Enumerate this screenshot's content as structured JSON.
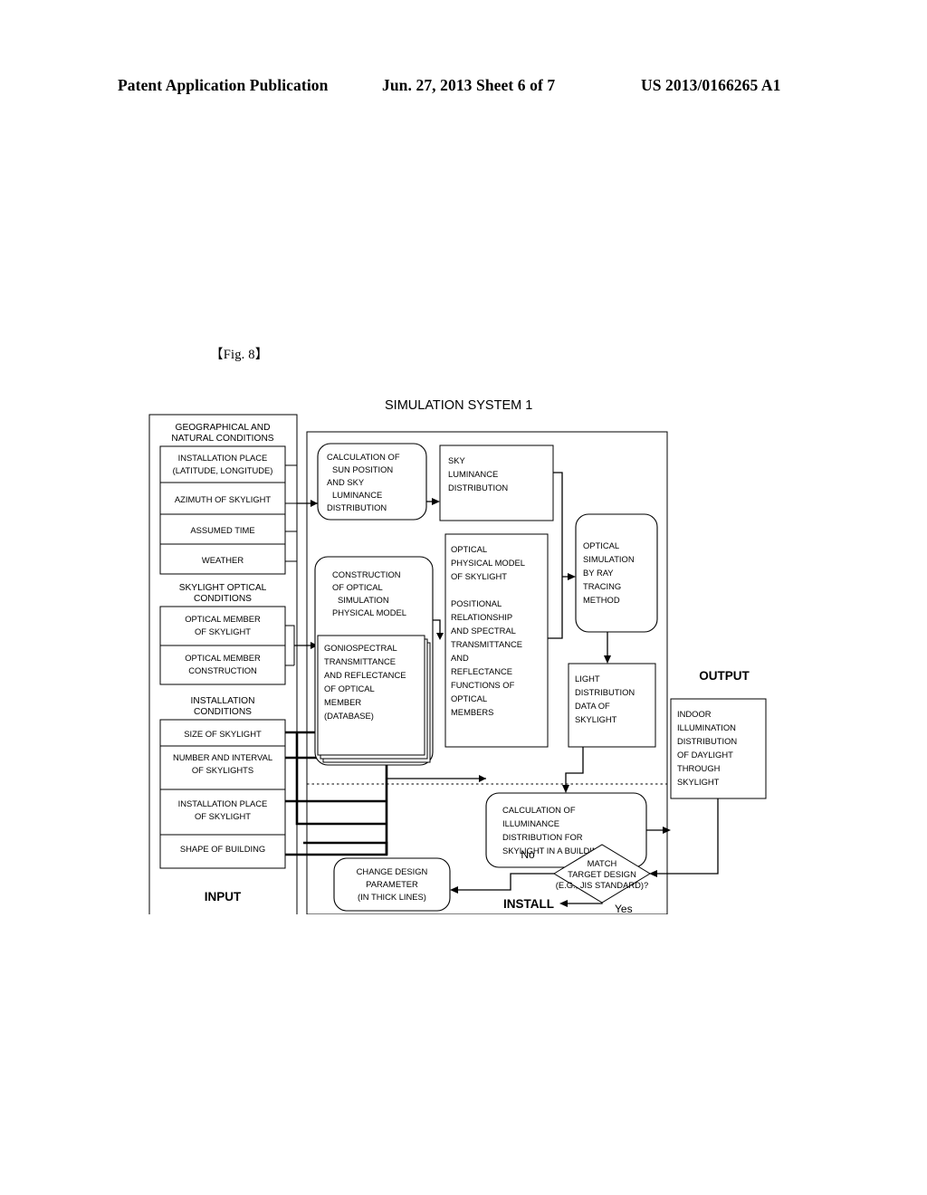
{
  "header": {
    "left": "Patent Application Publication",
    "middle": "Jun. 27, 2013  Sheet 6 of 7",
    "right": "US 2013/0166265 A1"
  },
  "figure_label": "【Fig. 8】",
  "diagram": {
    "title": "SIMULATION SYSTEM 1",
    "input_label": "INPUT",
    "output_label": "OUTPUT",
    "install_label": "INSTALL",
    "branch_no": "No",
    "branch_yes": "Yes",
    "input_groups": [
      {
        "heading": [
          "GEOGRAPHICAL AND",
          "NATURAL CONDITIONS"
        ],
        "items": [
          [
            "INSTALLATION PLACE",
            "(LATITUDE, LONGITUDE)"
          ],
          [
            "AZIMUTH OF SKYLIGHT"
          ],
          [
            "ASSUMED TIME"
          ],
          [
            "WEATHER"
          ]
        ]
      },
      {
        "heading": [
          "SKYLIGHT OPTICAL",
          "CONDITIONS"
        ],
        "items": [
          [
            "OPTICAL MEMBER",
            "OF SKYLIGHT"
          ],
          [
            "OPTICAL MEMBER",
            "CONSTRUCTION"
          ]
        ]
      },
      {
        "heading": [
          "INSTALLATION",
          "CONDITIONS"
        ],
        "items": [
          [
            "SIZE OF SKYLIGHT"
          ],
          [
            "NUMBER AND INTERVAL",
            "OF SKYLIGHTS"
          ],
          [
            "INSTALLATION PLACE",
            "OF SKYLIGHT"
          ],
          [
            "SHAPE OF BUILDING"
          ]
        ]
      }
    ],
    "nodes": {
      "calc_sun": [
        "CALCULATION OF",
        "SUN POSITION",
        "AND SKY",
        "LUMINANCE",
        "DISTRIBUTION"
      ],
      "sky_luminance": [
        "SKY",
        "   LUMINANCE",
        "   DISTRIBUTION"
      ],
      "construction": [
        "CONSTRUCTION",
        "OF OPTICAL",
        "SIMULATION",
        "PHYSICAL MODEL"
      ],
      "goniospectral": [
        "GONIOSPECTRAL",
        "TRANSMITTANCE",
        "AND REFLECTANCE",
        "OF OPTICAL",
        "MEMBER",
        "(DATABASE)"
      ],
      "optical_physical": [
        "OPTICAL",
        "  PHYSICAL MODEL",
        "  OF SKYLIGHT"
      ],
      "positional": [
        "POSITIONAL",
        "RELATIONSHIP",
        "AND SPECTRAL",
        "TRANSMITTANCE",
        "AND",
        "REFLECTANCE",
        "FUNCTIONS OF",
        "OPTICAL",
        "MEMBERS"
      ],
      "ray_tracing": [
        "OPTICAL",
        "SIMULATION",
        "BY RAY",
        "TRACING",
        "METHOD"
      ],
      "light_distribution": [
        "LIGHT",
        "DISTRIBUTION",
        "DATA OF",
        "SKYLIGHT"
      ],
      "calc_illuminance": [
        "CALCULATION OF",
        "ILLUMINANCE",
        "DISTRIBUTION FOR",
        "SKYLIGHT IN A BUILDING"
      ],
      "indoor_illumination": [
        "INDOOR",
        "  ILLUMINATION",
        "DISTRIBUTION",
        "OF DAYLIGHT",
        "THROUGH",
        "SKYLIGHT"
      ],
      "change_design": [
        "CHANGE DESIGN",
        "PARAMETER",
        "(IN THICK LINES)"
      ],
      "decision": [
        "MATCH",
        "TARGET DESIGN",
        "(E.G., JIS STANDARD)?"
      ]
    }
  }
}
